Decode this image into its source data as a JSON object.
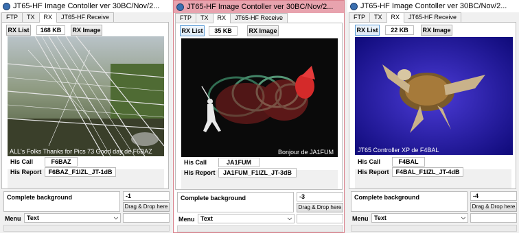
{
  "windows": [
    {
      "title": "JT65-HF Image Contoller ver 30BC/Nov/2...",
      "tabs": [
        "FTP",
        "TX",
        "RX",
        "JT65-HF Receive"
      ],
      "selected_tab": "RX",
      "rx_list_label": "RX List",
      "file_size": "168 KB",
      "rx_image_label": "RX Image",
      "image_caption": "ALL's Folks Thanks for Pics 73 Good day de F6BAZ",
      "his_call_label": "His Call",
      "his_call": "F6BAZ",
      "his_report_label": "His Report",
      "his_report": "F6BAZ_F1IZL_JT-1dB",
      "complete_background": "Complete background",
      "number": "-1",
      "drag_drop": "Drag & Drop here",
      "menu_label": "Menu",
      "menu_value": "Text"
    },
    {
      "title": "JT65-HF Image Contoller ver 30BC/Nov/2...",
      "tabs": [
        "FTP",
        "TX",
        "RX",
        "JT65-HF Receive"
      ],
      "selected_tab": "RX",
      "rx_list_label": "RX List",
      "file_size": "35 KB",
      "rx_image_label": "RX Image",
      "image_caption": "Bonjour de JA1FUM",
      "his_call_label": "His Call",
      "his_call": "JA1FUM",
      "his_report_label": "His Report",
      "his_report": "JA1FUM_F1IZL_JT-3dB",
      "complete_background": "Complete background",
      "number": "-3",
      "drag_drop": "Drag & Drop here",
      "menu_label": "Menu",
      "menu_value": "Text"
    },
    {
      "title": "JT65-HF Image Contoller ver 30BC/Nov/2...",
      "tabs": [
        "FTP",
        "TX",
        "RX",
        "JT65-HF Receive"
      ],
      "selected_tab": "RX",
      "rx_list_label": "RX List",
      "file_size": "22 KB",
      "rx_image_label": "RX Image",
      "image_caption": "JT65  Controller XP de F4BAL",
      "his_call_label": "His Call",
      "his_call": "F4BAL",
      "his_report_label": "His Report",
      "his_report": "F4BAL_F1IZL_JT-4dB",
      "complete_background": "Complete background",
      "number": "-4",
      "drag_drop": "Drag & Drop here",
      "menu_label": "Menu",
      "menu_value": "Text"
    }
  ],
  "icons": {
    "app": "app-icon",
    "dropdown": "chevron-down-icon"
  },
  "colors": {
    "active_window_border": "#d9808b",
    "active_titlebar": "#e8a3ae",
    "focus_button": "#5b9bd5"
  }
}
